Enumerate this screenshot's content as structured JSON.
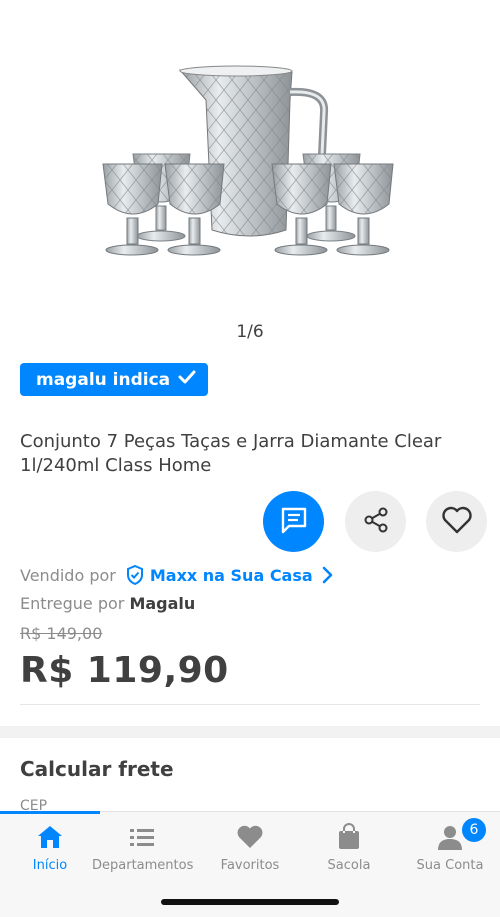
{
  "product": {
    "image_counter": "1/6",
    "badge_label": "magalu indica",
    "title": "Conjunto 7 Peças Taças e Jarra Diamante Clear 1l/240ml Class Home"
  },
  "actions": {
    "chat_icon": "chat-icon",
    "share_icon": "share-icon",
    "favorite_icon": "heart-icon"
  },
  "seller": {
    "sold_by_label": "Vendido por",
    "seller_name": "Maxx na Sua Casa",
    "delivered_by_label": "Entregue por",
    "delivered_by_name": "Magalu"
  },
  "pricing": {
    "old_price": "R$ 149,00",
    "current_price": "R$ 119,90"
  },
  "freight": {
    "title": "Calcular frete",
    "cep_label": "CEP"
  },
  "bottom_nav": {
    "items": [
      {
        "label": "Início",
        "icon": "home-icon",
        "active": true
      },
      {
        "label": "Departamentos",
        "icon": "list-icon",
        "active": false
      },
      {
        "label": "Favoritos",
        "icon": "heart-icon",
        "active": false
      },
      {
        "label": "Sacola",
        "icon": "bag-icon",
        "active": false
      },
      {
        "label": "Sua Conta",
        "icon": "user-icon",
        "active": false
      }
    ],
    "account_badge_count": "6"
  },
  "colors": {
    "accent": "#0086ff",
    "text": "#404040",
    "muted": "#8c8c8c"
  }
}
